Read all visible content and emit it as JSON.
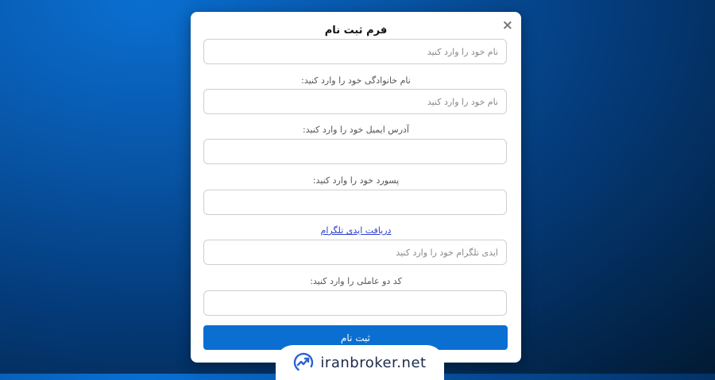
{
  "modal": {
    "close_glyph": "×",
    "title": "فرم ثبت نام",
    "fields": [
      {
        "placeholder": "نام خود را وارد کنید"
      },
      {
        "label": "نام خانوادگی خود را وارد کنید:",
        "placeholder": "نام خود را وارد کنید"
      },
      {
        "label": "آدرس ایمیل خود را وارد کنید:",
        "placeholder": ""
      },
      {
        "label": "پسورد خود را وارد کنید:",
        "placeholder": ""
      },
      {
        "link": "دریافت ایدی تلگرام",
        "placeholder": "ایدی تلگرام خود را وارد کنید"
      },
      {
        "label": "کد دو عاملی را وارد کنید:",
        "placeholder": ""
      }
    ],
    "submit_label": "ثبت نام"
  },
  "brand": {
    "name": "iranbroker.net",
    "logo_icon": "chart-trend-icon",
    "accent_color": "#2a63d4"
  },
  "colors": {
    "submit": "#0b6fd1",
    "link": "#2b3fcf"
  }
}
